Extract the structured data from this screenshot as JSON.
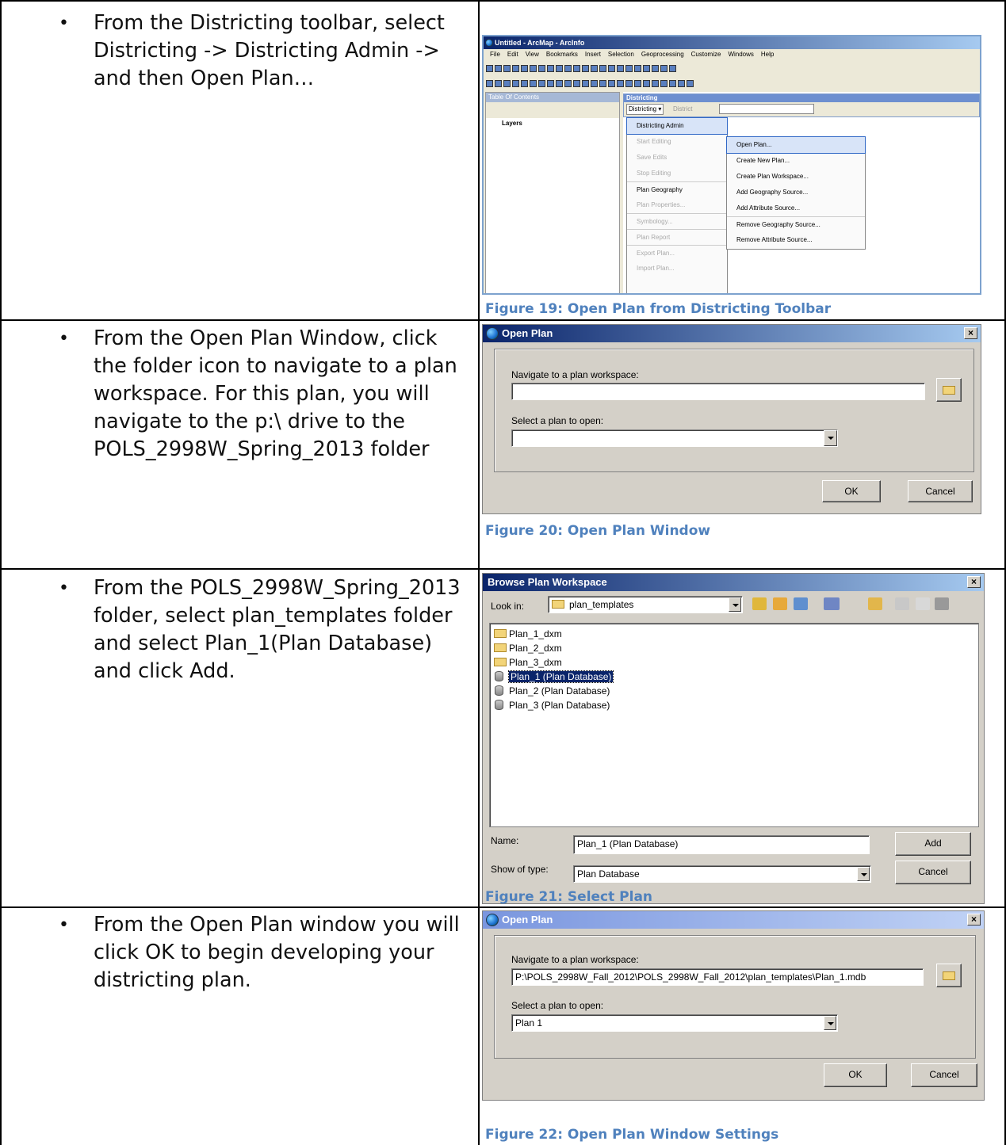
{
  "steps": [
    {
      "bullet": "•",
      "text": "From the Districting toolbar, select Districting -> Districting Admin -> and then Open Plan…"
    },
    {
      "bullet": "•",
      "text": "From the Open Plan Window, click the folder icon to navigate to a plan workspace. For this plan, you will navigate to the p:\\ drive to the POLS_2998W_Spring_2013 folder"
    },
    {
      "bullet": "•",
      "text": "From the POLS_2998W_Spring_2013 folder, select plan_templates folder and select Plan_1(Plan Database) and click Add."
    },
    {
      "bullet": "•",
      "text": "From the Open Plan window you will click OK to begin developing your districting plan."
    }
  ],
  "captions": {
    "fig19": "Figure 19: Open Plan from Districting Toolbar",
    "fig20": "Figure 20: Open Plan Window",
    "fig21": "Figure 21: Select Plan",
    "fig22": "Figure 22: Open Plan Window Settings"
  },
  "arcmap": {
    "title": "Untitled - ArcMap - ArcInfo",
    "menus": [
      "File",
      "Edit",
      "View",
      "Bookmarks",
      "Insert",
      "Selection",
      "Geoprocessing",
      "Customize",
      "Windows",
      "Help"
    ],
    "toc_title": "Table Of Contents",
    "layers": "Layers",
    "toolbar_title": "Districting",
    "districting_btn": "Districting ▾",
    "district_label": "District",
    "menu1": [
      "Districting Admin",
      "Start Editing",
      "Save Edits",
      "Stop Editing",
      "Plan Geography",
      "Plan Properties...",
      "Symbology...",
      "Plan Report",
      "Export Plan...",
      "Import Plan..."
    ],
    "menu2": [
      "Open Plan...",
      "Create New Plan...",
      "Create Plan Workspace...",
      "Add Geography Source...",
      "Add Attribute Source...",
      "Remove Geography Source...",
      "Remove Attribute Source..."
    ]
  },
  "open_plan": {
    "title": "Open Plan",
    "nav_label": "Navigate to a plan workspace:",
    "nav_value": "",
    "select_label": "Select a plan to open:",
    "select_value": "",
    "ok": "OK",
    "cancel": "Cancel",
    "close": "×"
  },
  "browse": {
    "title": "Browse Plan Workspace",
    "look_in_label": "Look in:",
    "look_in_value": "plan_templates",
    "items": [
      "Plan_1_dxm",
      "Plan_2_dxm",
      "Plan_3_dxm",
      "Plan_1 (Plan Database)",
      "Plan_2 (Plan Database)",
      "Plan_3 (Plan Database)"
    ],
    "name_label": "Name:",
    "name_value": "Plan_1 (Plan Database)",
    "type_label": "Show of type:",
    "type_value": "Plan Database",
    "add": "Add",
    "cancel": "Cancel",
    "close": "×"
  },
  "open_plan2": {
    "title": "Open Plan",
    "nav_label": "Navigate to a plan workspace:",
    "nav_value": "P:\\POLS_2998W_Fall_2012\\POLS_2998W_Fall_2012\\plan_templates\\Plan_1.mdb",
    "select_label": "Select a plan to open:",
    "select_value": "Plan 1",
    "ok": "OK",
    "cancel": "Cancel",
    "close": "×"
  }
}
